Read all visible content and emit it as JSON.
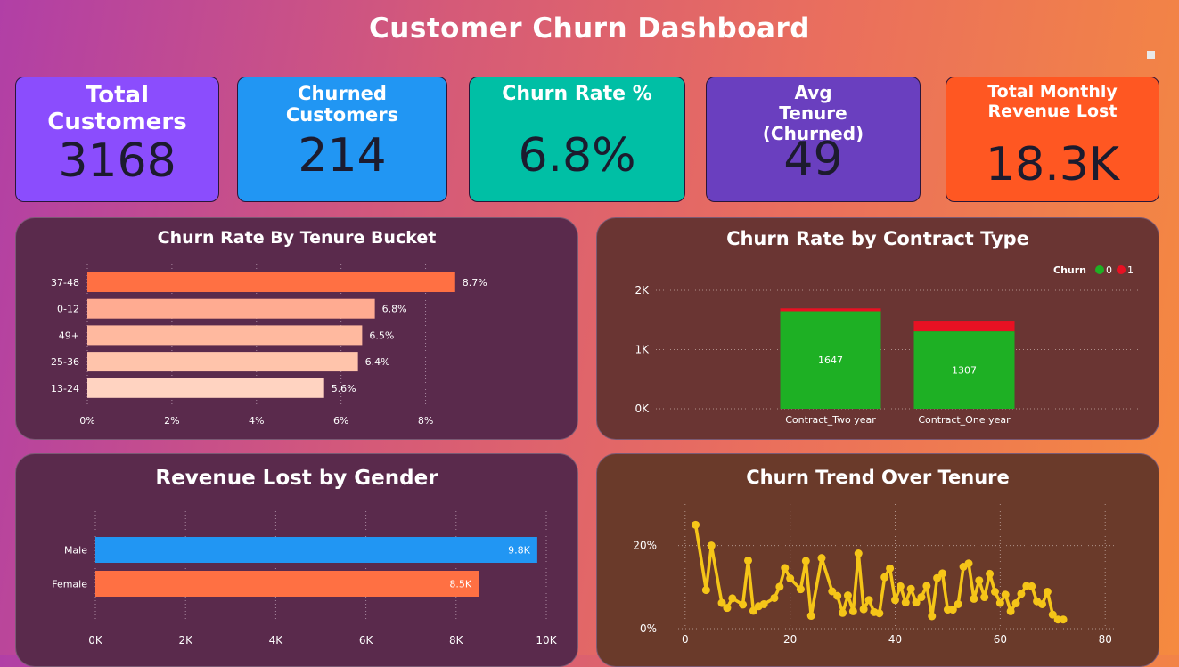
{
  "header": {
    "title": "Customer Churn Dashboard"
  },
  "kpis": [
    {
      "label": "Total Customers",
      "value": "3168",
      "color": "#8b4dfd"
    },
    {
      "label": "Churned Customers",
      "value": "214",
      "color": "#2196f3"
    },
    {
      "label": "Churn Rate %",
      "value": "6.8%",
      "color": "#00bfa5"
    },
    {
      "label": "Avg Tenure (Churned)",
      "value": "49",
      "color": "#6a3fbf"
    },
    {
      "label": "Total Monthly Revenue Lost",
      "value": "18.3K",
      "color": "#ff5722"
    }
  ],
  "chart_data": [
    {
      "type": "bar",
      "orientation": "horizontal",
      "title": "Churn Rate By Tenure Bucket",
      "categories": [
        "37-48",
        "0-12",
        "49+",
        "25-36",
        "13-24"
      ],
      "values": [
        8.7,
        6.8,
        6.5,
        6.4,
        5.6
      ],
      "data_labels": [
        "8.7%",
        "6.8%",
        "6.5%",
        "6.4%",
        "5.6%"
      ],
      "bar_colors": [
        "#ff7043",
        "#ffab91",
        "#ffb99f",
        "#ffc4ab",
        "#ffd3c1"
      ],
      "xlim": [
        0,
        9
      ],
      "xticks": [
        "0%",
        "2%",
        "4%",
        "6%",
        "8%"
      ],
      "xtick_values": [
        0,
        2,
        4,
        6,
        8
      ],
      "grid": true
    },
    {
      "type": "bar",
      "stacked": true,
      "title": "Churn Rate by Contract Type",
      "categories": [
        "Contract_Two year",
        "Contract_One year"
      ],
      "series": [
        {
          "name": "0",
          "values": [
            1647,
            1307
          ],
          "color": "#1eb024"
        },
        {
          "name": "1",
          "values": [
            48,
            166
          ],
          "color": "#e81123"
        }
      ],
      "data_labels": [
        "1647",
        "1307"
      ],
      "legend_title": "Churn",
      "legend_position": "top-right",
      "ylim": [
        0,
        2000
      ],
      "yticks": [
        "0K",
        "1K",
        "2K"
      ],
      "ytick_values": [
        0,
        1000,
        2000
      ],
      "grid": true
    },
    {
      "type": "bar",
      "orientation": "horizontal",
      "title": "Revenue Lost by Gender",
      "categories": [
        "Male",
        "Female"
      ],
      "values": [
        9800,
        8500
      ],
      "data_labels": [
        "9.8K",
        "8.5K"
      ],
      "bar_colors": [
        "#2196f3",
        "#ff7043"
      ],
      "xlim": [
        0,
        10000
      ],
      "xticks": [
        "0K",
        "2K",
        "4K",
        "6K",
        "8K",
        "10K"
      ],
      "xtick_values": [
        0,
        2000,
        4000,
        6000,
        8000,
        10000
      ],
      "grid": true
    },
    {
      "type": "line",
      "title": "Churn Trend Over Tenure",
      "x": [
        2,
        4,
        5,
        7,
        8,
        9,
        11,
        12,
        13,
        14,
        15,
        17,
        18,
        19,
        20,
        22,
        23,
        24,
        26,
        28,
        29,
        30,
        31,
        32,
        33,
        34,
        35,
        36,
        37,
        38,
        39,
        40,
        41,
        42,
        43,
        44,
        45,
        46,
        47,
        48,
        49,
        50,
        51,
        52,
        53,
        54,
        55,
        56,
        57,
        58,
        59,
        60,
        61,
        62,
        63,
        64,
        65,
        66,
        67,
        68,
        69,
        70,
        71,
        72
      ],
      "y": [
        25,
        9.3,
        20,
        6.2,
        5,
        7.3,
        5.8,
        16.4,
        4.3,
        5.4,
        5.9,
        7.4,
        10.1,
        14.6,
        12.1,
        9.5,
        16.3,
        3.1,
        17,
        9,
        7.9,
        3.8,
        8,
        4.2,
        18.1,
        4.7,
        6.9,
        4,
        3.7,
        12.4,
        14.5,
        6.9,
        10.2,
        6.3,
        9.6,
        6.3,
        7.6,
        10.3,
        3,
        12.2,
        13.3,
        4.6,
        4.6,
        5.9,
        14.9,
        15.7,
        7.2,
        11.6,
        7.6,
        13.2,
        8.9,
        6.2,
        8.2,
        4.2,
        6.1,
        8.4,
        10.3,
        10.2,
        6.6,
        5.9,
        8.9,
        3.4,
        2.2,
        2.2
      ],
      "xlim": [
        -2,
        82
      ],
      "ylim": [
        0,
        30
      ],
      "xticks": [
        "0",
        "20",
        "40",
        "60",
        "80"
      ],
      "xtick_values": [
        0,
        20,
        40,
        60,
        80
      ],
      "yticks": [
        "0%",
        "20%"
      ],
      "ytick_values": [
        0,
        20
      ],
      "color": "#f5c518",
      "grid": true
    }
  ]
}
